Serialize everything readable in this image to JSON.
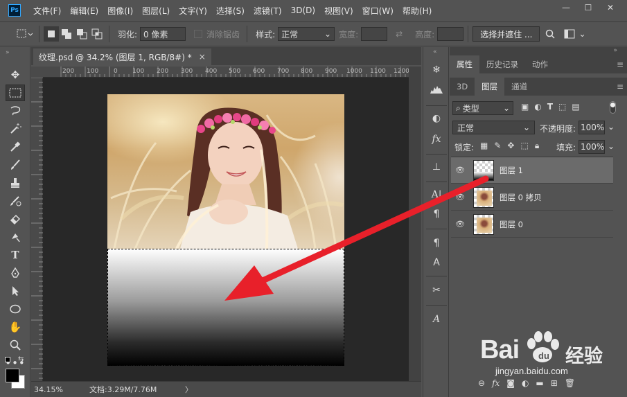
{
  "app": {
    "logo": "Ps"
  },
  "menu": [
    "文件(F)",
    "编辑(E)",
    "图像(I)",
    "图层(L)",
    "文字(Y)",
    "选择(S)",
    "滤镜(T)",
    "3D(D)",
    "视图(V)",
    "窗口(W)",
    "帮助(H)"
  ],
  "window_controls": {
    "minimize": "—",
    "maximize": "☐",
    "close": "✕"
  },
  "options": {
    "feather_label": "羽化:",
    "feather_value": "0 像素",
    "antialias_label": "消除锯齿",
    "style_label": "样式:",
    "style_value": "正常",
    "width_label": "宽度:",
    "height_label": "高度:",
    "select_mask_button": "选择并遮住 ..."
  },
  "document": {
    "tab_title": "纹理.psd @ 34.2% (图层 1, RGB/8#) *",
    "close": "×",
    "zoom": "34.15%",
    "doc_size": "文档:3.29M/7.76M"
  },
  "ruler": {
    "labels": [
      "200",
      "100",
      "0",
      "100",
      "200",
      "300",
      "400",
      "500",
      "600",
      "700",
      "800",
      "900",
      "1000",
      "1100",
      "1200"
    ]
  },
  "properties_panel": {
    "tabs": [
      "属性",
      "历史记录",
      "动作"
    ]
  },
  "layers_panel": {
    "tabs": [
      "3D",
      "图层",
      "通道"
    ],
    "filter_kind": "类型",
    "blend_mode": "正常",
    "opacity_label": "不透明度:",
    "opacity_value": "100%",
    "lock_label": "锁定:",
    "fill_label": "填充:",
    "fill_value": "100%",
    "layers": [
      {
        "name": "图层 1",
        "selected": true
      },
      {
        "name": "图层 0 拷贝",
        "selected": false
      },
      {
        "name": "图层 0",
        "selected": false
      }
    ],
    "bottom_icons": [
      "link-icon",
      "fx-icon",
      "mask-icon",
      "adjustment-icon",
      "group-icon",
      "new-layer-icon",
      "trash-icon"
    ]
  },
  "annotation": {
    "arrow_color": "#e8202a"
  },
  "watermark": {
    "brand": "Bai",
    "brand_cn": "经验",
    "url": "jingyan.baidu.com"
  }
}
